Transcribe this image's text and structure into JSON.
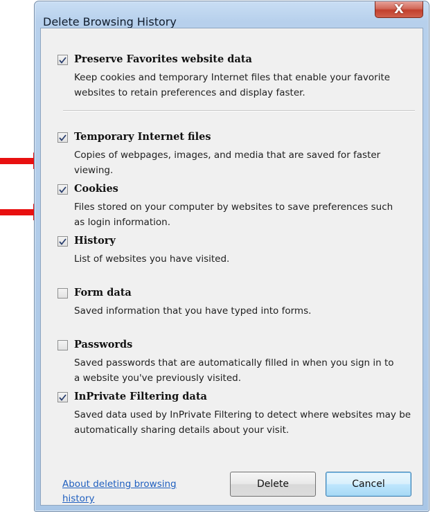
{
  "window": {
    "title": "Delete Browsing History",
    "close_glyph": "X"
  },
  "options": [
    {
      "label": "Preserve Favorites website data",
      "checked": true,
      "description": "Keep cookies and temporary Internet files that enable your favorite websites to retain preferences and display faster."
    },
    {
      "label": "Temporary Internet files",
      "checked": true,
      "description": "Copies of webpages, images, and media that are saved for faster viewing."
    },
    {
      "label": "Cookies",
      "checked": true,
      "description": "Files stored on your computer by websites to save preferences such as login information."
    },
    {
      "label": "History",
      "checked": true,
      "description": "List of websites you have visited."
    },
    {
      "label": "Form data",
      "checked": false,
      "description": "Saved information that you have typed into forms."
    },
    {
      "label": "Passwords",
      "checked": false,
      "description": "Saved passwords that are automatically filled in when you sign in to a website you've previously visited."
    },
    {
      "label": "InPrivate Filtering data",
      "checked": true,
      "description": "Saved data used by InPrivate Filtering to detect where websites may be automatically sharing details about your visit."
    }
  ],
  "footer": {
    "help_link": "About deleting browsing history",
    "delete_label": "Delete",
    "cancel_label": "Cancel"
  },
  "annotations": {
    "arrow_color": "#e81010"
  },
  "colors": {
    "frame": "#b7d0ec",
    "client": "#f0f0f0",
    "link": "#1f5fbf"
  }
}
